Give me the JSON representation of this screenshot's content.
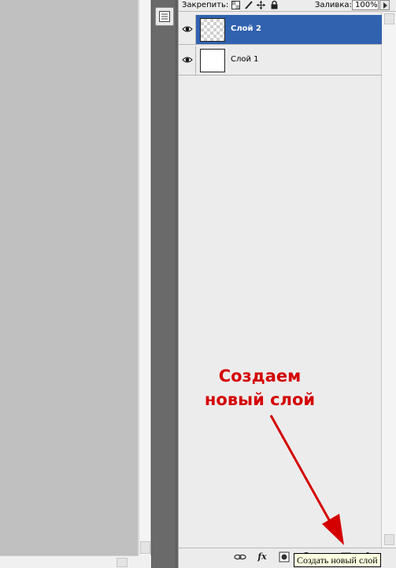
{
  "lock_bar": {
    "lock_label": "Закрепить:",
    "fill_label": "Заливка:",
    "fill_value": "100%"
  },
  "layers": [
    {
      "name": "Слой 2",
      "selected": true,
      "thumbnail": "transparent"
    },
    {
      "name": "Слой 1",
      "selected": false,
      "thumbnail": "white"
    }
  ],
  "footer_icons": [
    "link-icon",
    "fx-icon",
    "mask-icon",
    "adjustment-icon",
    "folder-icon",
    "new-layer-icon",
    "trash-icon"
  ],
  "footer_fx_label": "fx",
  "annotation": {
    "line1": "Создаем",
    "line2": "новый слой",
    "color": "#d40000"
  },
  "tooltip": "Создать новый слой",
  "colors": {
    "selected_row": "#3162b0",
    "panel_bg": "#ececec",
    "canvas_bg": "#c0c0c0"
  }
}
